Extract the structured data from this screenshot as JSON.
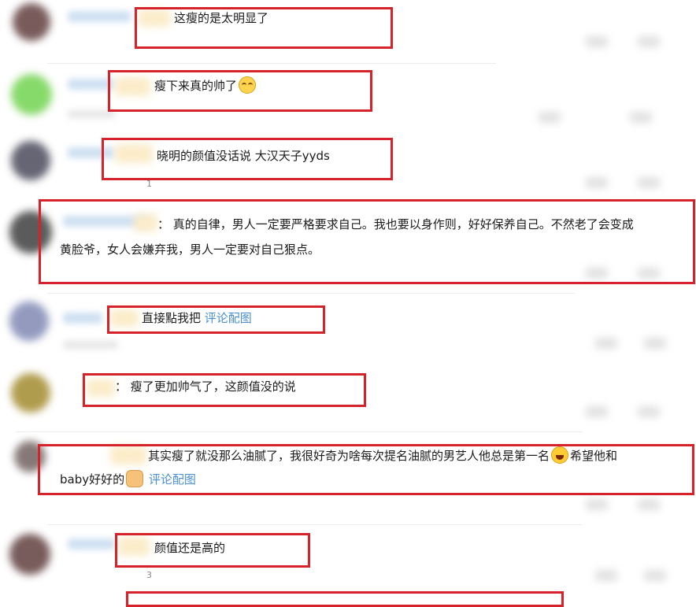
{
  "comments": [
    {
      "text": "这瘦的是太明显了"
    },
    {
      "text": "瘦下来真的帅了",
      "emoji": "smile-emoji"
    },
    {
      "text": "晓明的颜值没话说 大汉天子yyds",
      "reply_count": "1"
    },
    {
      "prefix": "：",
      "line1": "真的自律，男人一定要严格要求自己。我也要以身作则，好好保养自己。不然老了会变成",
      "line2": "黄脸爷，女人会嫌弃我，男人一定要对自己狠点。"
    },
    {
      "text": "直接點我把",
      "link": "评论配图"
    },
    {
      "prefix": "：",
      "text": "瘦了更加帅气了，这颜值没的说"
    },
    {
      "line1": "其实瘦了就没那么油腻了，我很好奇为啥每次提名油腻的男艺人他总是第一名",
      "emoji1": "laugh-cry-emoji",
      "line1_tail": "希望他和",
      "line2": "baby好好的",
      "emoji2": "fist-emoji",
      "link": "评论配图"
    },
    {
      "text": "颜值还是高的",
      "reply_count": "3"
    }
  ],
  "colors": {
    "highlight_box": "#d5222b",
    "link": "#4a90d0"
  }
}
